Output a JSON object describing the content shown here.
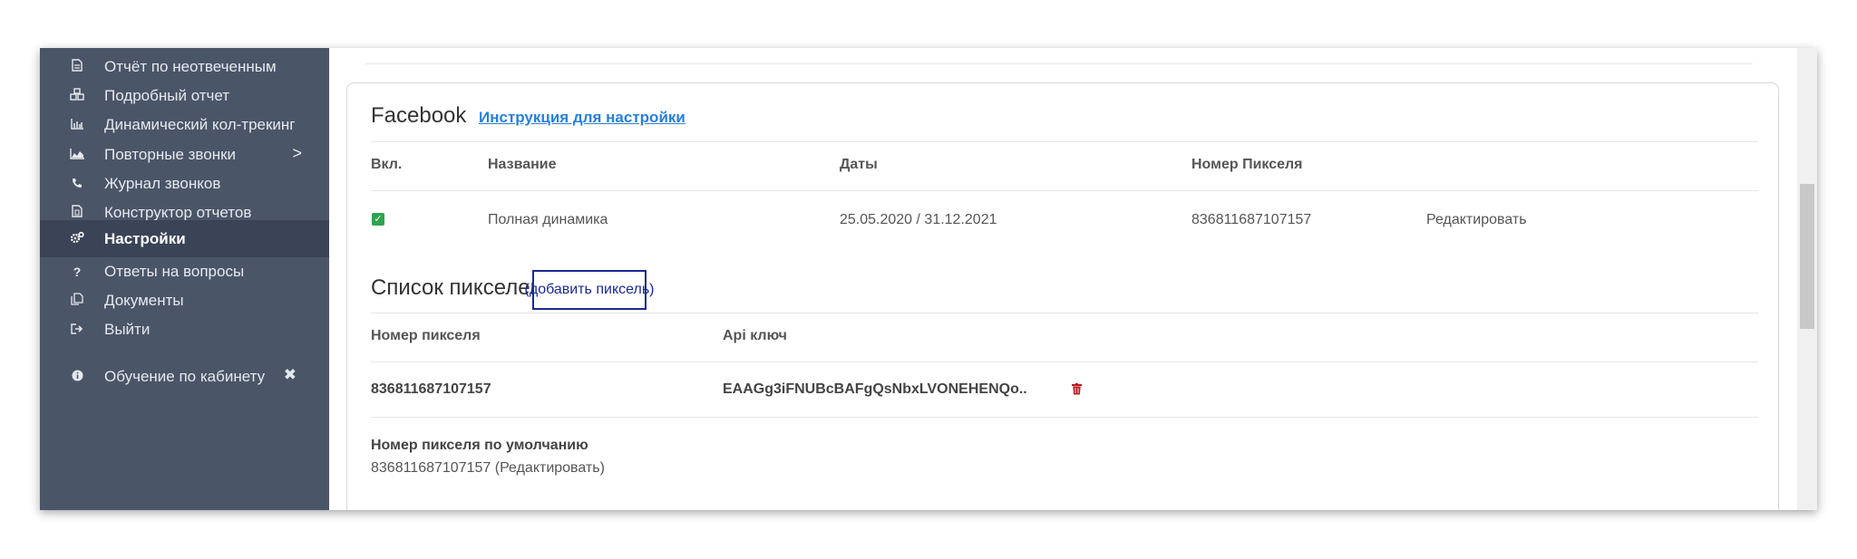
{
  "sidebar": {
    "items": [
      {
        "label": "Отчёт по неотвеченным",
        "icon": "file-icon"
      },
      {
        "label": "Подробный отчет",
        "icon": "cubes-icon"
      },
      {
        "label": "Динамический кол-трекинг",
        "icon": "bar-chart-icon"
      },
      {
        "label": "Повторные звонки",
        "icon": "area-chart-icon",
        "chevron": ">"
      },
      {
        "label": "Журнал звонков",
        "icon": "phone-icon"
      },
      {
        "label": "Конструктор отчетов",
        "icon": "file-builder-icon"
      },
      {
        "label": "Настройки",
        "icon": "gears-icon",
        "active": true
      },
      {
        "label": "Ответы на вопросы",
        "icon": "question-icon"
      },
      {
        "label": "Документы",
        "icon": "documents-icon"
      },
      {
        "label": "Выйти",
        "icon": "sign-out-icon"
      }
    ],
    "training": {
      "label": "Обучение по кабинету",
      "icon": "info-icon",
      "close": "✖"
    }
  },
  "facebook": {
    "title": "Facebook",
    "instructions_link": "Инструкция для настройки",
    "table": {
      "headers": [
        "Вкл.",
        "Название",
        "Даты",
        "Номер Пикселя"
      ],
      "row": {
        "enabled": true,
        "name": "Полная динамика",
        "dates": "25.05.2020 / 31.12.2021",
        "pixel": "836811687107157",
        "action": "Редактировать"
      }
    }
  },
  "pixels": {
    "title": "Список пикселей",
    "add_button": "(добавить пиксель)",
    "headers": [
      "Номер пикселя",
      "Api ключ"
    ],
    "row": {
      "pixel": "836811687107157",
      "api_key": "EAAGg3iFNUBcBAFgQsNbxLVONEHENQo.."
    },
    "default_label": "Номер пикселя по умолчанию",
    "default_value": "836811687107157 (Редактировать)"
  },
  "colors": {
    "sidebar": "#4b5568",
    "active": "#3b4456",
    "link": "#2a7fd8",
    "checkbox": "#2ea44f",
    "trash": "#c0151b"
  }
}
